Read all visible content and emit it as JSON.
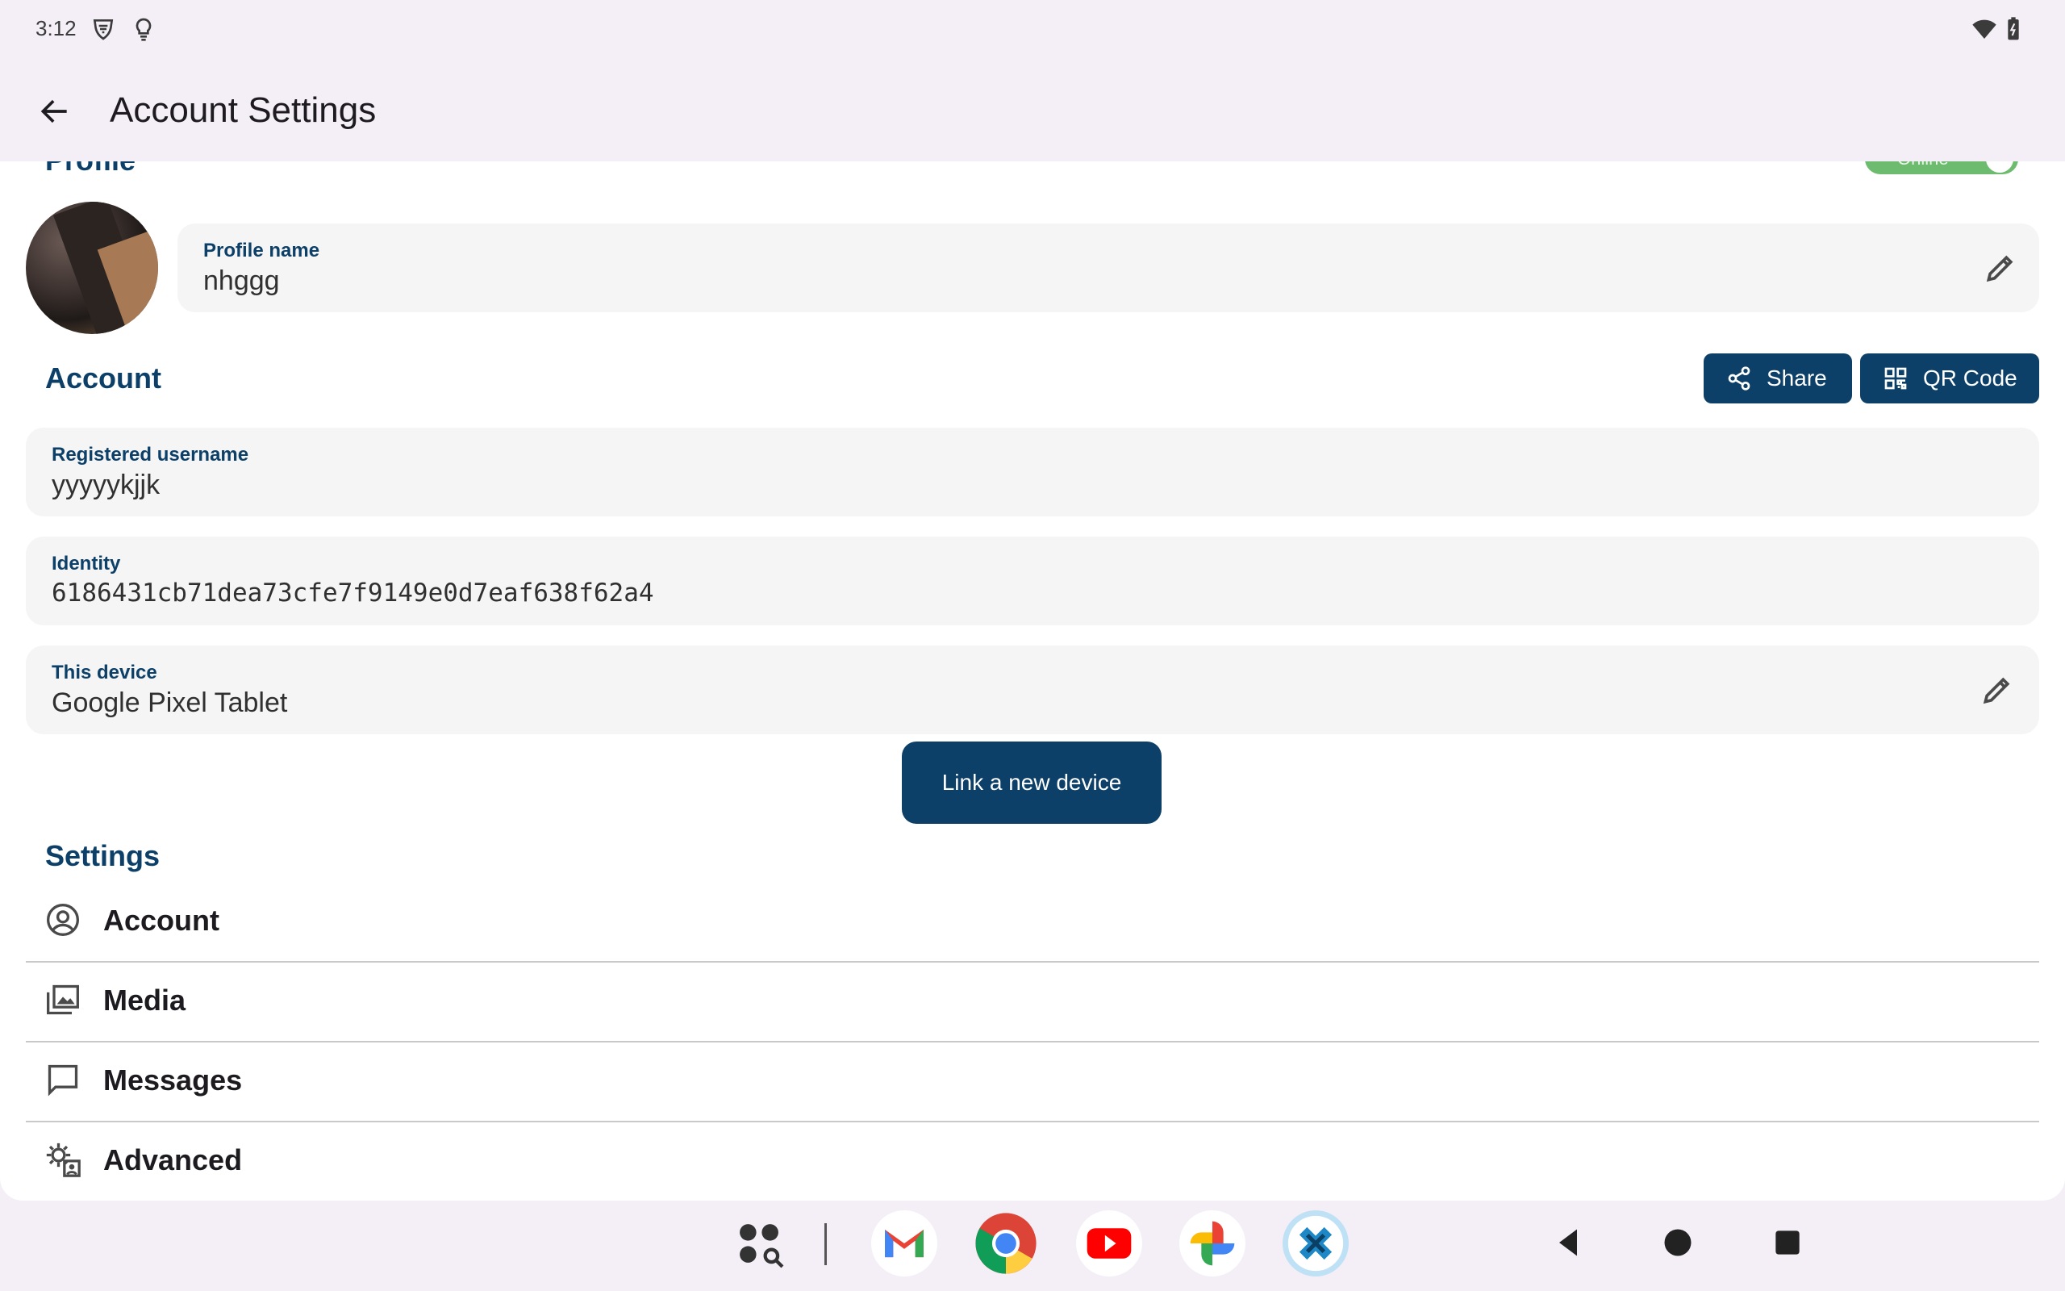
{
  "status_bar": {
    "time": "3:12",
    "left_icons": [
      "vpn-shield-icon",
      "lightbulb-icon"
    ],
    "right_icons": [
      "wifi-icon",
      "battery-icon"
    ]
  },
  "app_bar": {
    "title": "Account Settings",
    "back_icon": "arrow-back-icon"
  },
  "profile": {
    "heading": "Profile",
    "online_toggle_label": "Online",
    "online_toggle_on": true,
    "name_label": "Profile name",
    "name_value": "nhggg"
  },
  "account": {
    "title": "Account",
    "share_label": "Share",
    "qr_label": "QR Code",
    "username_label": "Registered username",
    "username_value": "yyyyykjjk",
    "identity_label": "Identity",
    "identity_value": "6186431cb71dea73cfe7f9149e0d7eaf638f62a4",
    "device_label": "This device",
    "device_value": "Google Pixel Tablet",
    "link_device_label": "Link a new device"
  },
  "settings": {
    "title": "Settings",
    "items": [
      {
        "label": "Account",
        "icon": "account-circle-icon"
      },
      {
        "label": "Media",
        "icon": "photo-library-icon"
      },
      {
        "label": "Messages",
        "icon": "chat-bubble-icon"
      },
      {
        "label": "Advanced",
        "icon": "manage-accounts-icon"
      }
    ]
  },
  "nav": {
    "dock_apps": [
      "app-drawer-icon",
      "gmail-icon",
      "chrome-icon",
      "youtube-icon",
      "photos-icon",
      "jami-icon"
    ],
    "buttons": [
      "back",
      "home",
      "recents"
    ]
  },
  "colors": {
    "accent": "#0d4068",
    "background": "#f4eef6",
    "surface": "#ffffff",
    "field": "#f5f5f5",
    "toggle_on": "#6dbb6f"
  }
}
